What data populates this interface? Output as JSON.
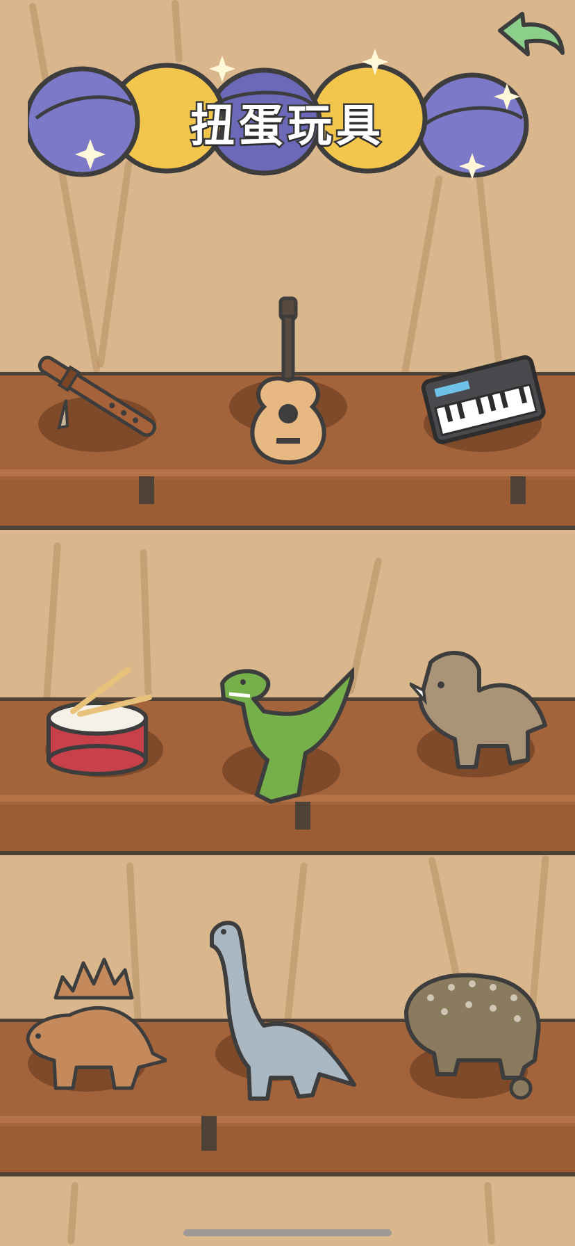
{
  "header": {
    "title": "扭蛋玩具",
    "back_icon": "back-arrow-icon"
  },
  "colors": {
    "wall": "#d9b68b",
    "shelf": "#a4643b",
    "outline": "#4e4236",
    "capsule_purple": "#7b79c8",
    "capsule_yellow": "#f2c64c",
    "back_green": "#8ccf8a"
  },
  "shelves": [
    {
      "items": [
        "flute-icon",
        "guitar-icon",
        "keyboard-synth-icon"
      ]
    },
    {
      "items": [
        "snare-drum-icon",
        "t-rex-icon",
        "triceratops-icon"
      ]
    },
    {
      "items": [
        "stegosaurus-icon",
        "brachiosaurus-icon",
        "ankylosaurus-icon"
      ]
    }
  ]
}
